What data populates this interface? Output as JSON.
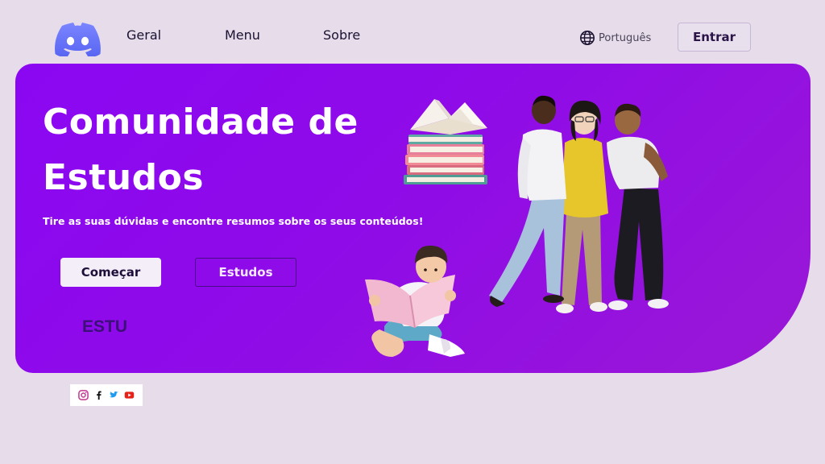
{
  "header": {
    "nav": [
      "Geral",
      "Menu",
      "Sobre"
    ],
    "language": "Português",
    "login_label": "Entrar"
  },
  "hero": {
    "title": "Comunidade de Estudos",
    "subtitle": "Tire as suas dúvidas e encontre resumos sobre os seus conteúdos!",
    "start_label": "Começar",
    "studies_label": "Estudos",
    "placeholder_text": "ESTU"
  },
  "social": {
    "icons": [
      "instagram-icon",
      "facebook-icon",
      "twitter-icon",
      "youtube-icon"
    ]
  },
  "colors": {
    "page_bg": "#e6dcea",
    "hero_gradient_start": "#8b07f2",
    "hero_gradient_end": "#9a18d6",
    "discord_blurple": "#5865f2",
    "button_dark_text": "#1e0f3a"
  }
}
